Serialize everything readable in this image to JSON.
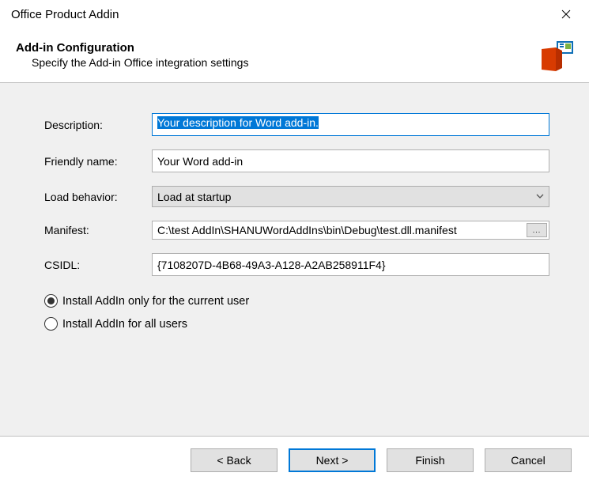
{
  "window": {
    "title": "Office Product Addin"
  },
  "header": {
    "heading": "Add-in Configuration",
    "subheading": "Specify the Add-in Office integration settings"
  },
  "form": {
    "description_label": "Description:",
    "description_value": "Your description for Word add-in.",
    "friendly_label": "Friendly name:",
    "friendly_value": "Your Word add-in",
    "load_label": "Load behavior:",
    "load_value": "Load at startup",
    "manifest_label": "Manifest:",
    "manifest_value": "C:\\test AddIn\\SHANUWordAddIns\\bin\\Debug\\test.dll.manifest",
    "browse_label": "...",
    "csidl_label": "CSIDL:",
    "csidl_value": "{7108207D-4B68-49A3-A128-A2AB258911F4}"
  },
  "radios": {
    "current_user_label": "Install AddIn only for the current user",
    "all_users_label": "Install AddIn for all users",
    "selected": "current_user"
  },
  "buttons": {
    "back": "< Back",
    "next": "Next >",
    "finish": "Finish",
    "cancel": "Cancel"
  }
}
